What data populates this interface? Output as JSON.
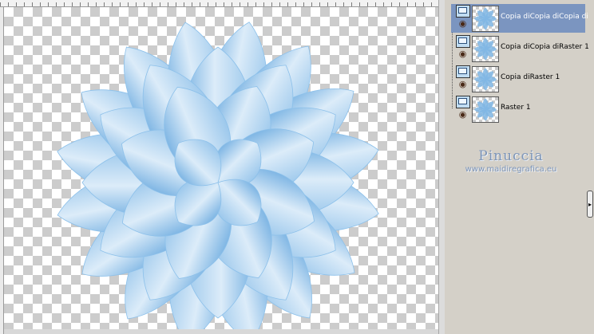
{
  "layers_panel": {
    "layers": [
      {
        "name": "Copia diCopia diCopia diR",
        "selected": true,
        "visible": true
      },
      {
        "name": "Copia diCopia diRaster 1",
        "selected": false,
        "visible": true
      },
      {
        "name": "Copia diRaster 1",
        "selected": false,
        "visible": true
      },
      {
        "name": "Raster 1",
        "selected": false,
        "visible": true
      }
    ],
    "watermark": {
      "name": "Pinuccia",
      "url": "www.maidiregrafica.eu"
    },
    "collapse_glyph": "▸"
  },
  "canvas": {
    "content": "blue-flower-petal-artwork",
    "petal_color_light": "#dcecf9",
    "petal_color_dark": "#7fb6e4",
    "transparency_checker": "#cccccc"
  },
  "icons": {
    "visibility": "layer-visibility-icon",
    "eye": "eye-icon",
    "expand": "panel-collapse-icon"
  }
}
